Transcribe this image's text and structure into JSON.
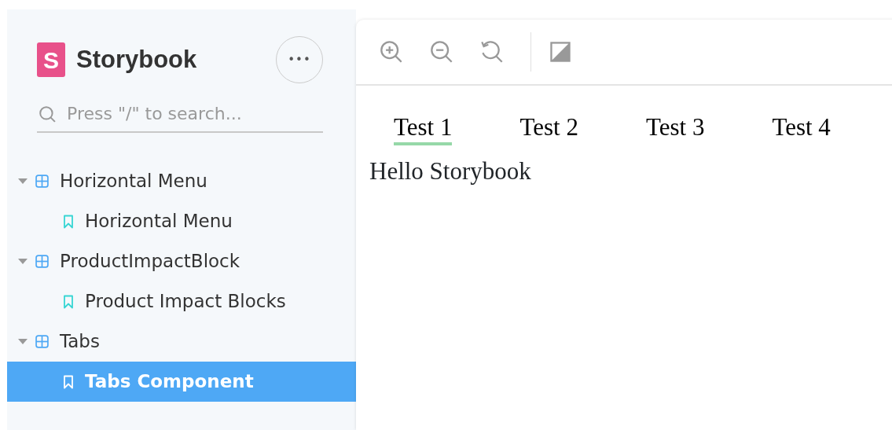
{
  "sidebar": {
    "brand": {
      "logo_letter": "S",
      "name": "Storybook"
    },
    "menu_button": {
      "label": "•••"
    },
    "search": {
      "placeholder": "Press \"/\" to search..."
    },
    "tree": [
      {
        "label": "Horizontal Menu",
        "kind": "component",
        "expanded": true,
        "children": [
          {
            "label": "Horizontal Menu",
            "kind": "story",
            "selected": false
          }
        ]
      },
      {
        "label": "ProductImpactBlock",
        "kind": "component",
        "expanded": true,
        "children": [
          {
            "label": "Product Impact Blocks",
            "kind": "story",
            "selected": false
          }
        ]
      },
      {
        "label": "Tabs",
        "kind": "component",
        "expanded": true,
        "children": [
          {
            "label": "Tabs Component",
            "kind": "story",
            "selected": true
          }
        ]
      }
    ]
  },
  "toolbar": {
    "tools": [
      {
        "kind": "zoom-in"
      },
      {
        "kind": "zoom-out"
      },
      {
        "kind": "zoom-reset"
      },
      {
        "kind": "divider"
      },
      {
        "kind": "background"
      }
    ]
  },
  "preview": {
    "tabs": [
      {
        "label": "Test 1",
        "selected": true
      },
      {
        "label": "Test 2",
        "selected": false
      },
      {
        "label": "Test 3",
        "selected": false
      },
      {
        "label": "Test 4",
        "selected": false
      }
    ],
    "content": "Hello Storybook"
  }
}
